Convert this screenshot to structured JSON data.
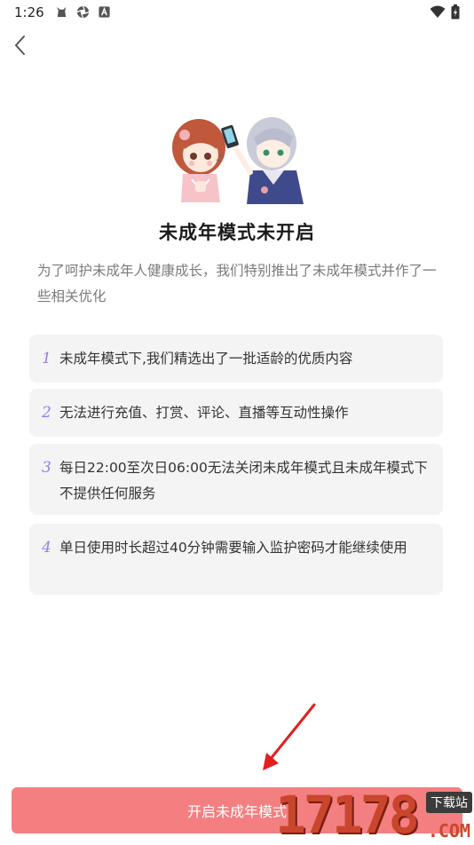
{
  "status_bar": {
    "time": "1:26",
    "left_icons": [
      "cat-notification-icon",
      "aperture-icon",
      "a-box-icon"
    ],
    "right_icons": [
      "wifi-icon",
      "battery-icon"
    ]
  },
  "nav": {
    "back_icon": "chevron-left-icon"
  },
  "illustration": "two-anime-characters-with-phone",
  "title": "未成年模式未开启",
  "description": "为了呵护未成年人健康成长，我们特别推出了未成年模式并作了一些相关优化",
  "items": [
    {
      "num": "1",
      "text": "未成年模式下,我们精选出了一批适龄的优质内容"
    },
    {
      "num": "2",
      "text": "无法进行充值、打赏、评论、直播等互动性操作"
    },
    {
      "num": "3",
      "text": "每日22:00至次日06:00无法关闭未成年模式且未成年模式下不提供任何服务"
    },
    {
      "num": "4",
      "text": "单日使用时长超过40分钟需要输入监护密码才能继续使用"
    }
  ],
  "button": {
    "label": "开启未成年模式"
  },
  "watermark": {
    "main": "17178",
    "tag": "下载站",
    "suffix": ".COM"
  },
  "colors": {
    "accent_number": "#9d7be6",
    "button_bg": "#f37f81",
    "annotation_arrow": "#e02020"
  }
}
